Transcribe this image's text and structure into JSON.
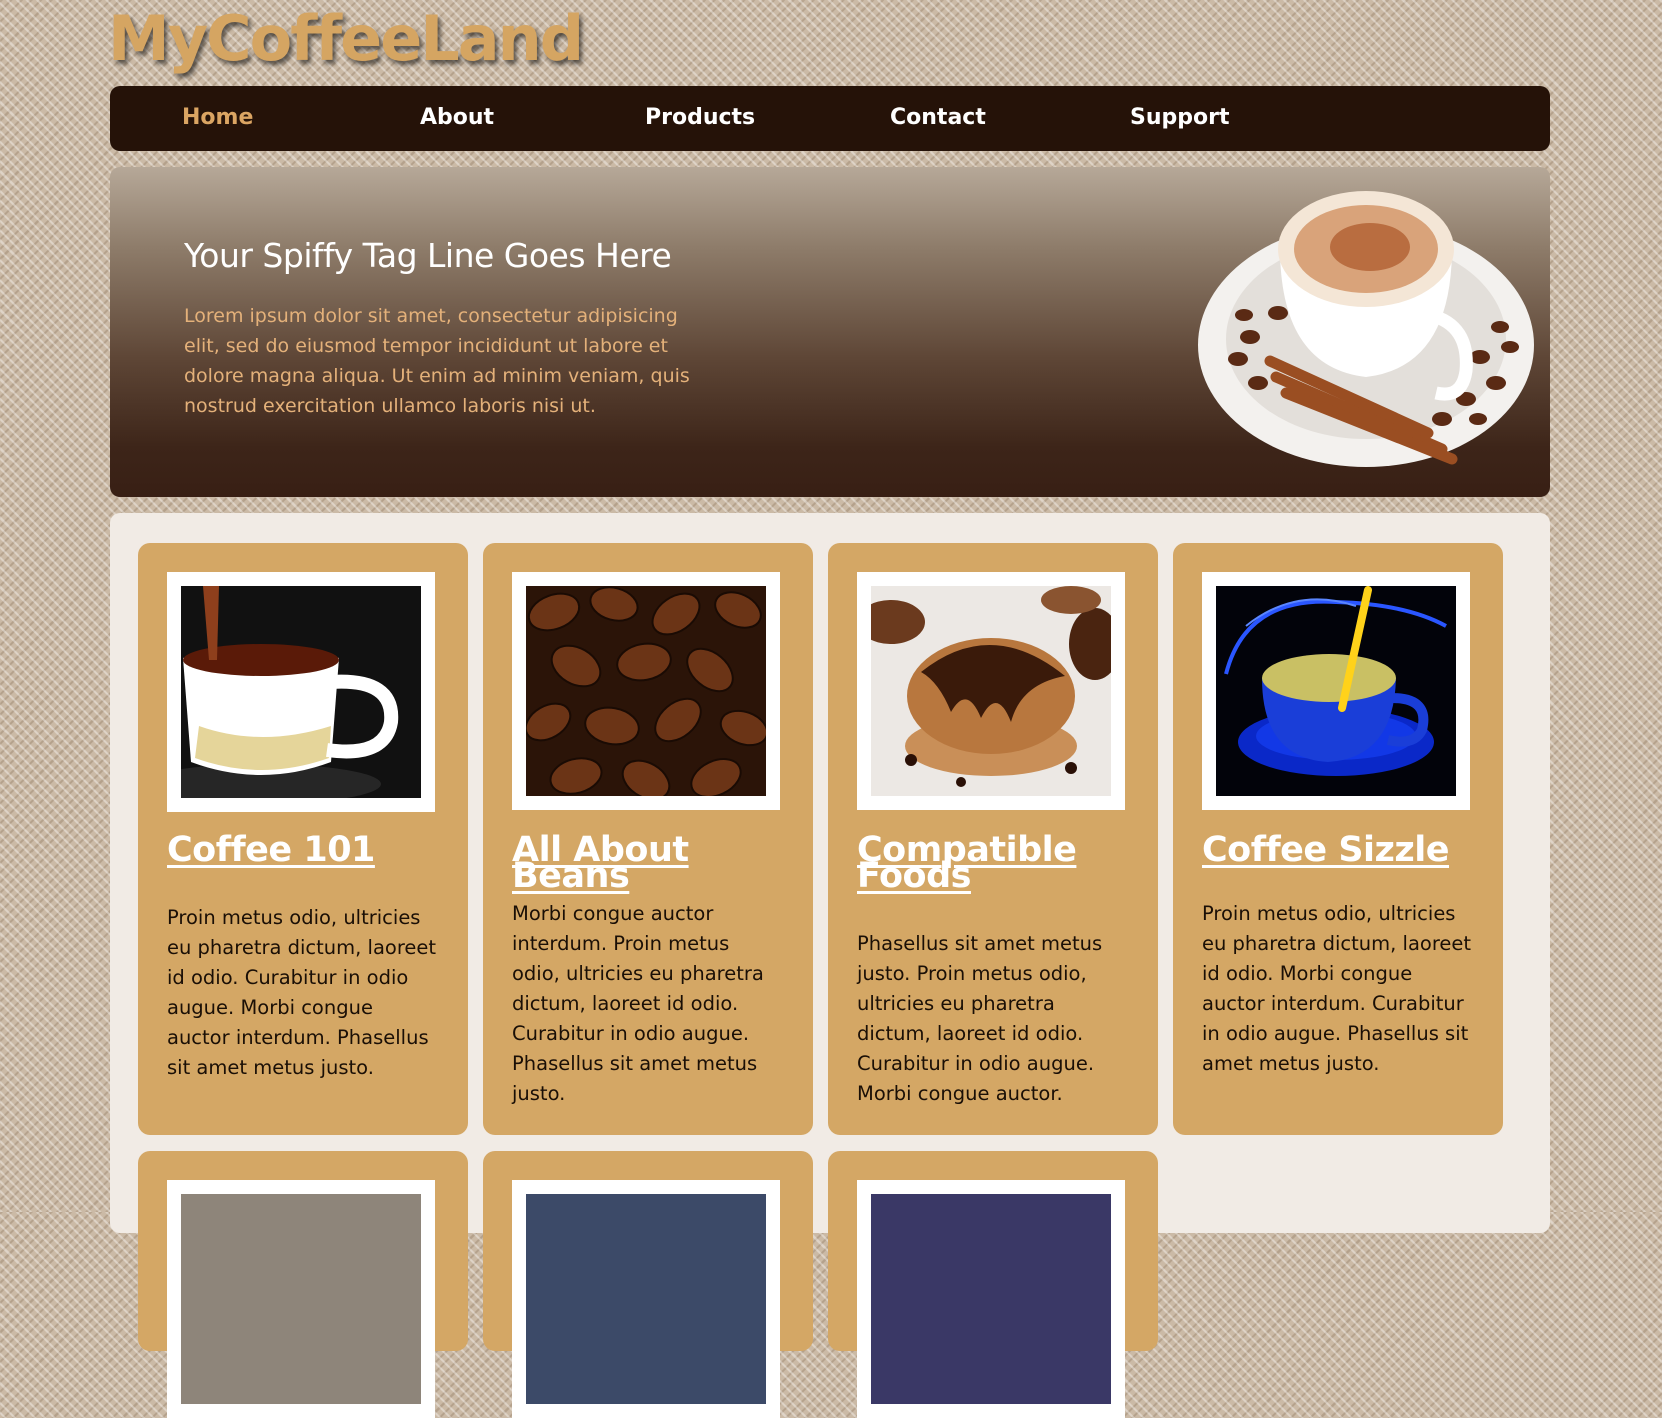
{
  "site": {
    "logo": "MyCoffeeLand"
  },
  "nav": [
    {
      "label": "Home",
      "active": true
    },
    {
      "label": "About",
      "active": false
    },
    {
      "label": "Products",
      "active": false
    },
    {
      "label": "Contact",
      "active": false
    },
    {
      "label": "Support",
      "active": false
    }
  ],
  "hero": {
    "title": "Your Spiffy Tag Line Goes Here",
    "text": "Lorem ipsum dolor sit amet, consectetur adipisicing elit, sed do eiusmod tempor incididunt ut labore et dolore magna aliqua. Ut enim ad minim veniam, quis nostrud exercitation ullamco laboris nisi ut.",
    "image": "cappuccino-cup-with-coffee-beans-and-cinnamon"
  },
  "cards": [
    {
      "title": "Coffee 101",
      "text": "Proin metus odio, ultricies eu pharetra dictum, laoreet id odio. Curabitur in odio augue. Morbi congue auctor interdum. Phasellus sit amet metus justo.",
      "image": "tea-cup-pouring"
    },
    {
      "title": "All About Beans",
      "text": "Morbi congue auctor interdum. Proin metus odio, ultricies eu pharetra dictum, laoreet id odio. Curabitur in odio augue. Phasellus sit amet metus justo.",
      "image": "coffee-beans"
    },
    {
      "title": "Compatible Foods",
      "text": "Phasellus sit amet metus justo. Proin metus odio, ultricies eu pharetra dictum, laoreet id odio. Curabitur in odio augue. Morbi congue auctor.",
      "image": "chocolate-muffin"
    },
    {
      "title": "Coffee Sizzle",
      "text": "Proin metus odio, ultricies eu pharetra dictum, laoreet id odio. Morbi congue auctor interdum. Curabitur in odio augue. Phasellus sit amet metus justo.",
      "image": "blue-neon-cup"
    }
  ],
  "colors": {
    "accent": "#d4a765",
    "nav_bg": "#251208",
    "nav_active": "#dba563",
    "page_bg": "#cbbaa6",
    "content_bg": "#f1ebe5"
  }
}
